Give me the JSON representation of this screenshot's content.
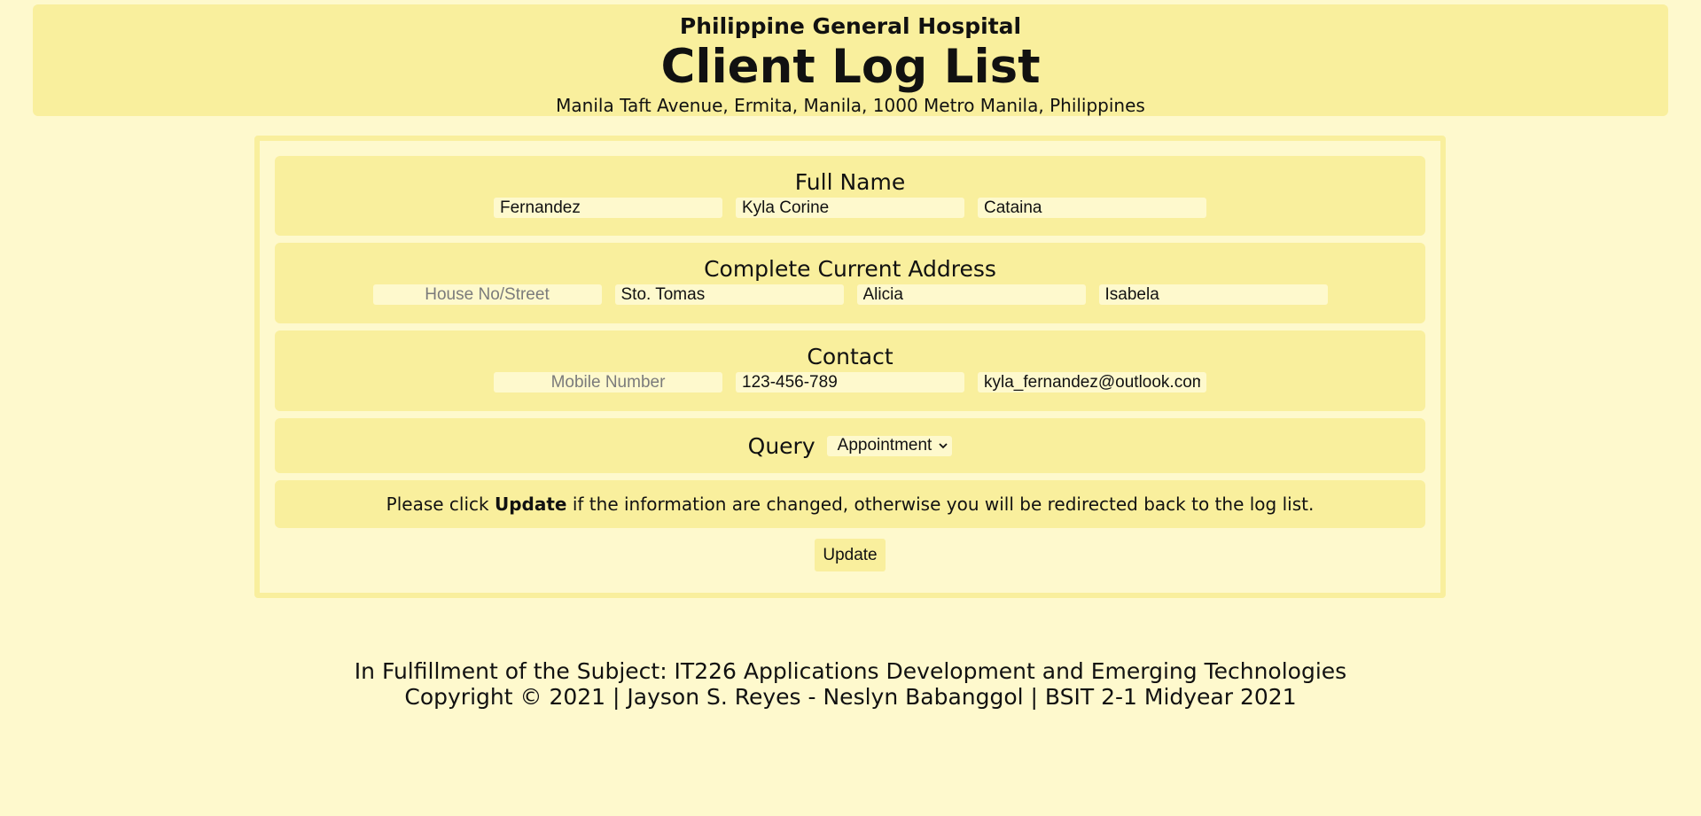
{
  "header": {
    "hospital": "Philippine General Hospital",
    "title": "Client Log List",
    "address": "Manila Taft Avenue, Ermita, Manila, 1000 Metro Manila, Philippines"
  },
  "form": {
    "full_name": {
      "label": "Full Name",
      "last_name": "Fernandez",
      "first_name": "Kyla Corine",
      "middle_name": "Cataina"
    },
    "address": {
      "label": "Complete Current Address",
      "street_value": "",
      "street_placeholder": "House No/Street",
      "barangay": "Sto. Tomas",
      "city": "Alicia",
      "province": "Isabela"
    },
    "contact": {
      "label": "Contact",
      "mobile_value": "",
      "mobile_placeholder": "Mobile Number",
      "phone": "123-456-789",
      "email": "kyla_fernandez@outlook.com"
    },
    "query": {
      "label": "Query",
      "selected": "Appointment",
      "icon": "chevron-down-icon"
    },
    "note": {
      "before": "Please click ",
      "emphasis": "Update",
      "after": " if the information are changed, otherwise you will be redirected back to the log list."
    },
    "update_label": "Update"
  },
  "footer": {
    "line1": "In Fulfillment of the Subject: IT226 Applications Development and Emerging Technologies",
    "line2": "Copyright © 2021 | Jayson S. Reyes - Neslyn Babanggol | BSIT 2-1 Midyear 2021"
  },
  "colors": {
    "page_background": "#fef9cd",
    "panel_background": "#f9ef9d",
    "text": "#111111",
    "placeholder": "#7b7b7b"
  }
}
